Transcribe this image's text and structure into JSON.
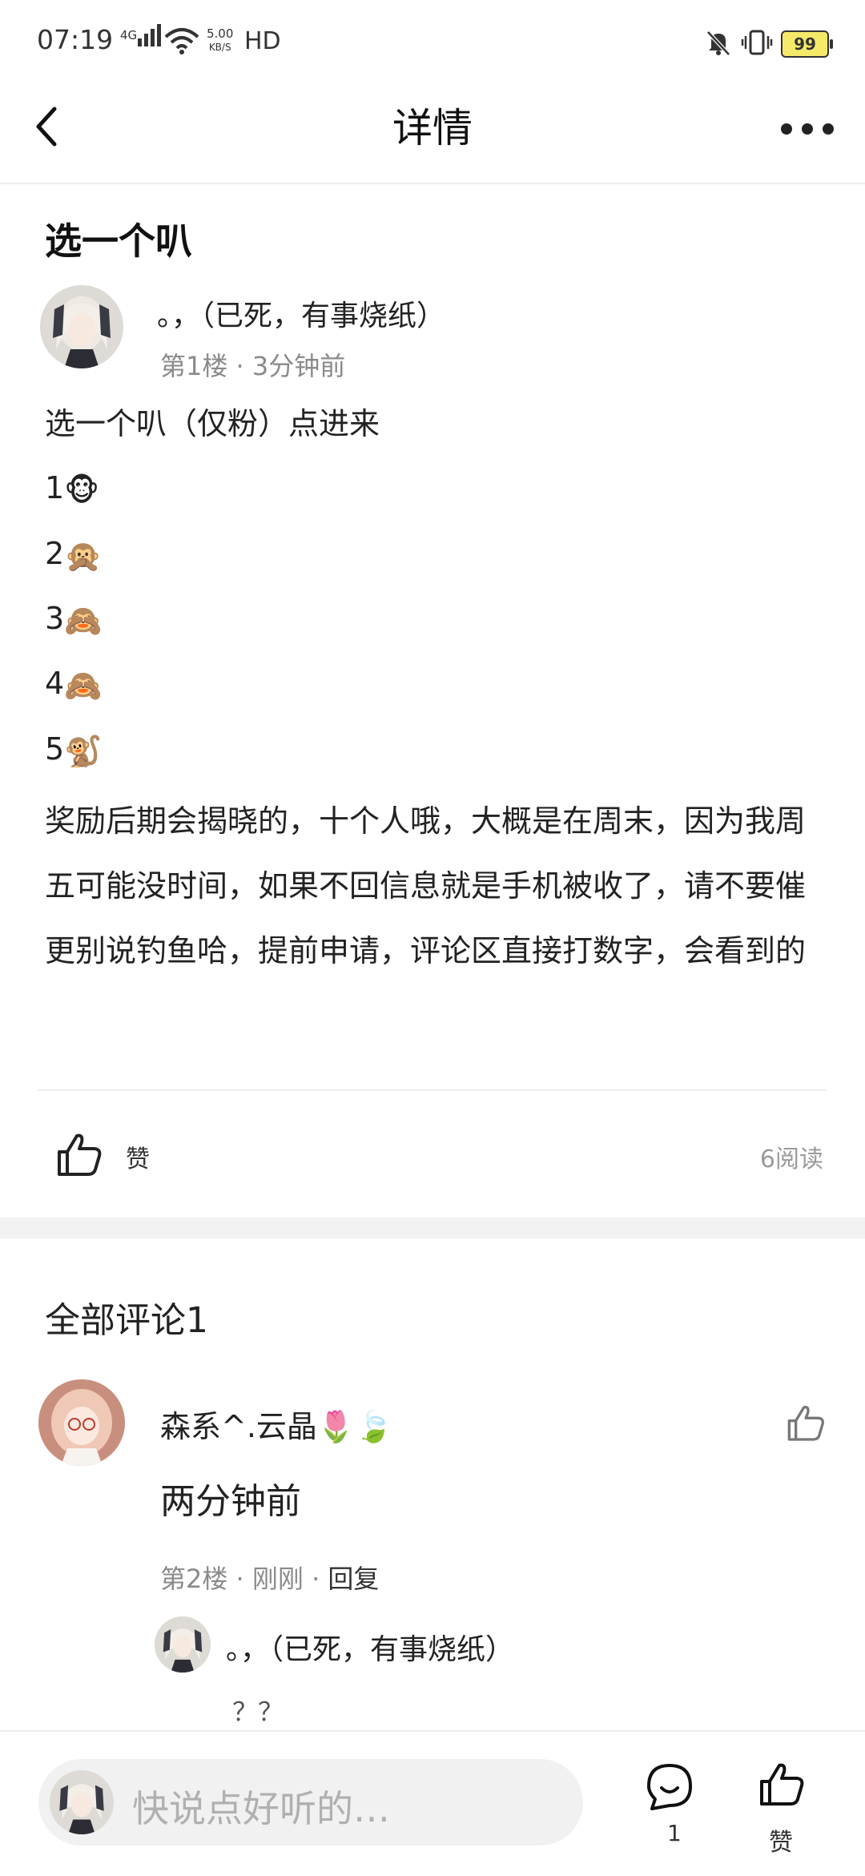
{
  "status_bar": {
    "time": "07:19",
    "network": "4G",
    "speed_value": "5.00",
    "speed_unit": "KB/S",
    "hd": "HD",
    "battery": "99"
  },
  "header": {
    "title": "详情"
  },
  "post": {
    "title": "选一个叭",
    "author": "。，（已死，有事烧纸）",
    "floor_info": "第1楼 · 3分钟前",
    "intro": "选一个叭（仅粉）点进来",
    "options": [
      {
        "num": "1",
        "emoji": "🐵"
      },
      {
        "num": "2",
        "emoji": "🙊"
      },
      {
        "num": "3",
        "emoji": "🙈"
      },
      {
        "num": "4",
        "emoji": "🙈"
      },
      {
        "num": "5",
        "emoji": "🐒"
      }
    ],
    "paragraph": "奖励后期会揭晓的，十个人哦，大概是在周末，因为我周五可能没时间，如果不回信息就是手机被收了，请不要催 更别说钓鱼哈，提前申请，评论区直接打数字，会看到的",
    "like_label": "赞",
    "reads": "6阅读"
  },
  "comments": {
    "title": "全部评论1",
    "items": [
      {
        "user": "森系^.云晶🌷🍃",
        "text": "两分钟前",
        "floor": "第2楼",
        "time": "刚刚",
        "reply_label": "回复",
        "reply": {
          "user": "。，（已死，有事烧纸）",
          "text": "？？"
        }
      }
    ]
  },
  "bottom_bar": {
    "placeholder": "快说点好听的…",
    "comment_count": "1",
    "like_label": "赞"
  }
}
